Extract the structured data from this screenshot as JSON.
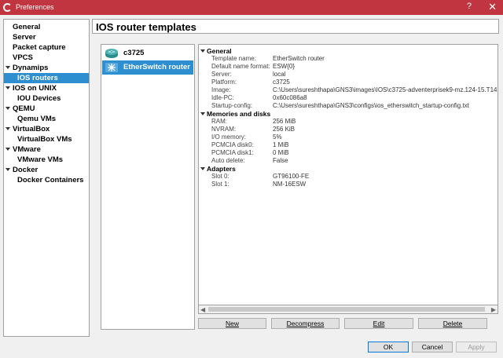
{
  "window": {
    "title": "Preferences",
    "help": "?",
    "close": "✕"
  },
  "sidebar": {
    "items": [
      {
        "label": "General"
      },
      {
        "label": "Server"
      },
      {
        "label": "Packet capture"
      },
      {
        "label": "VPCS"
      },
      {
        "label": "Dynamips"
      },
      {
        "label": "IOS routers"
      },
      {
        "label": "IOS on UNIX"
      },
      {
        "label": "IOU Devices"
      },
      {
        "label": "QEMU"
      },
      {
        "label": "Qemu VMs"
      },
      {
        "label": "VirtualBox"
      },
      {
        "label": "VirtualBox VMs"
      },
      {
        "label": "VMware"
      },
      {
        "label": "VMware VMs"
      },
      {
        "label": "Docker"
      },
      {
        "label": "Docker Containers"
      }
    ],
    "selected": "IOS routers"
  },
  "page": {
    "title": "IOS router templates"
  },
  "templates": [
    {
      "label": "c3725",
      "icon": "router-icon"
    },
    {
      "label": "EtherSwitch router",
      "icon": "switch-icon"
    }
  ],
  "details": {
    "general": {
      "label": "General",
      "rows": [
        {
          "key": "Template name:",
          "value": "EtherSwitch router"
        },
        {
          "key": "Default name format:",
          "value": "ESW{0}"
        },
        {
          "key": "Server:",
          "value": "local"
        },
        {
          "key": "Platform:",
          "value": "c3725"
        },
        {
          "key": "Image:",
          "value": "C:\\Users\\sureshthapa\\GNS3\\images\\IOS\\c3725-adventerprisek9-mz.124-15.T14."
        },
        {
          "key": "Idle-PC:",
          "value": "0x60c086a8"
        },
        {
          "key": "Startup-config:",
          "value": "C:\\Users\\sureshthapa\\GNS3\\configs\\ios_etherswitch_startup-config.txt"
        }
      ]
    },
    "memories": {
      "label": "Memories and disks",
      "rows": [
        {
          "key": "RAM:",
          "value": "256 MiB"
        },
        {
          "key": "NVRAM:",
          "value": "256 KiB"
        },
        {
          "key": "I/O memory:",
          "value": "5%"
        },
        {
          "key": "PCMCIA disk0:",
          "value": "1 MiB"
        },
        {
          "key": "PCMCIA disk1:",
          "value": "0 MiB"
        },
        {
          "key": "Auto delete:",
          "value": "False"
        }
      ]
    },
    "adapters": {
      "label": "Adapters",
      "rows": [
        {
          "key": "Slot 0:",
          "value": "GT96100-FE"
        },
        {
          "key": "Slot 1:",
          "value": "NM-16ESW"
        }
      ]
    }
  },
  "buttons": {
    "new": "New",
    "decompress": "Decompress",
    "edit": "Edit",
    "delete": "Delete",
    "ok": "OK",
    "cancel": "Cancel",
    "apply": "Apply"
  },
  "colors": {
    "titlebar": "#c0353f",
    "selection": "#2e8fd0"
  }
}
